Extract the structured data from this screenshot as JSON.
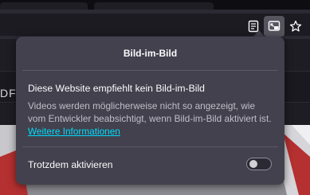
{
  "toolbar": {
    "buttons": [
      {
        "icon": "reader-view-icon"
      },
      {
        "icon": "picture-in-picture-icon",
        "active": true
      },
      {
        "icon": "bookmark-star-icon"
      }
    ]
  },
  "background_page": {
    "partial_text": "DF"
  },
  "panel": {
    "title": "Bild-im-Bild",
    "heading": "Diese Website empfiehlt kein Bild-im-Bild",
    "body_text": "Videos werden möglicherweise nicht so angezeigt, wie vom Entwickler beabsichtigt, wenn Bild-im-Bild aktiviert ist.",
    "learn_more_link": "Weitere Informationen",
    "toggle_label": "Trotzdem aktivieren",
    "toggle_enabled": false
  },
  "colors": {
    "panel_bg": "#42414d",
    "link": "#00ddff",
    "toolbar_bg": "#2b2a33",
    "active_button": "#56555f"
  }
}
